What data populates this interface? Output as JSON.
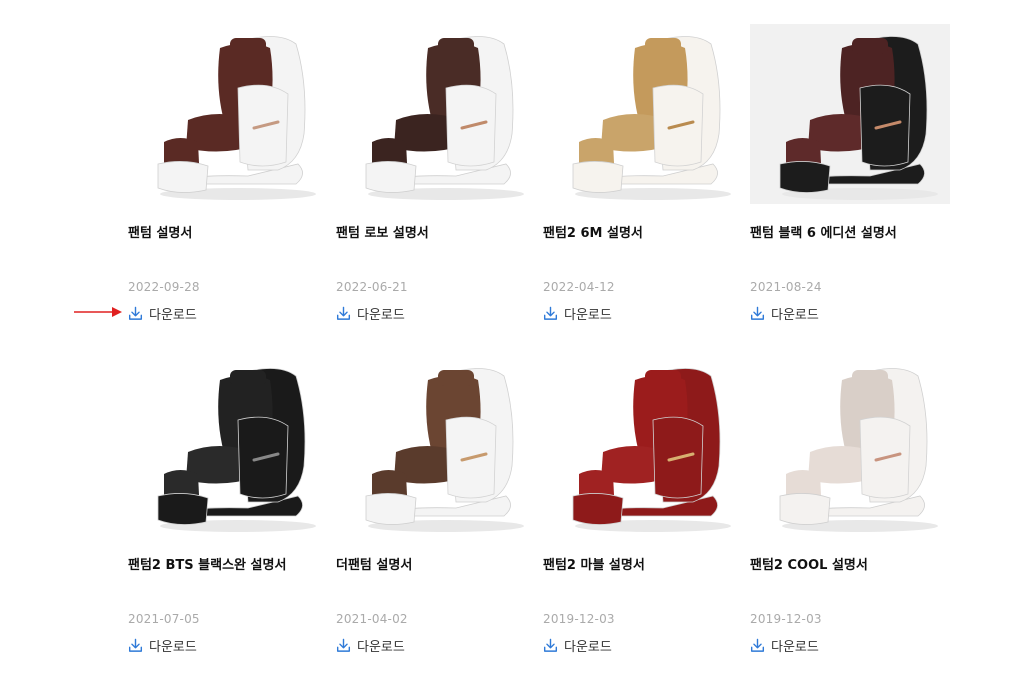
{
  "download_label": "다운로드",
  "products": [
    {
      "name": "팬텀 설명서",
      "date": "2022-09-28",
      "colors": {
        "body": "#f4f4f4",
        "seat": "#5a2a24",
        "accent": "#c59a82",
        "back": "#5a2a24"
      }
    },
    {
      "name": "팬텀 로보 설명서",
      "date": "2022-06-21",
      "colors": {
        "body": "#f4f4f4",
        "seat": "#3b2420",
        "accent": "#c08a6a",
        "back": "#4a2c26"
      }
    },
    {
      "name": "팬텀2 6M 설명서",
      "date": "2022-04-12",
      "colors": {
        "body": "#f6f3ee",
        "seat": "#c9a46a",
        "accent": "#b98b4f",
        "back": "#c49a5c"
      }
    },
    {
      "name": "팬텀 블랙 6 에디션 설명서",
      "date": "2021-08-24",
      "colors": {
        "body": "#1c1c1c",
        "seat": "#5e2a2a",
        "accent": "#c58a6a",
        "back": "#4d2323"
      }
    },
    {
      "name": "팬텀2 BTS 블랙스완 설명서",
      "date": "2021-07-05",
      "colors": {
        "body": "#1a1a1a",
        "seat": "#2a2a2a",
        "accent": "#888888",
        "back": "#222222"
      }
    },
    {
      "name": "더팬텀 설명서",
      "date": "2021-04-02",
      "colors": {
        "body": "#f4f4f4",
        "seat": "#5a3b2c",
        "accent": "#c79a6d",
        "back": "#6b4532"
      }
    },
    {
      "name": "팬텀2 마블 설명서",
      "date": "2019-12-03",
      "colors": {
        "body": "#8e1a1a",
        "seat": "#a02222",
        "accent": "#d7b070",
        "back": "#9b1c1c"
      }
    },
    {
      "name": "팬텀2 COOL 설명서",
      "date": "2019-12-03",
      "colors": {
        "body": "#f4f2f0",
        "seat": "#e6dcd6",
        "accent": "#c8947f",
        "back": "#d9cfc8"
      }
    }
  ],
  "icons": {
    "download": "download-icon",
    "pointer": "arrow-right-icon"
  },
  "accent_blue": "#2f7ad8",
  "pointer_red": "#e02020"
}
